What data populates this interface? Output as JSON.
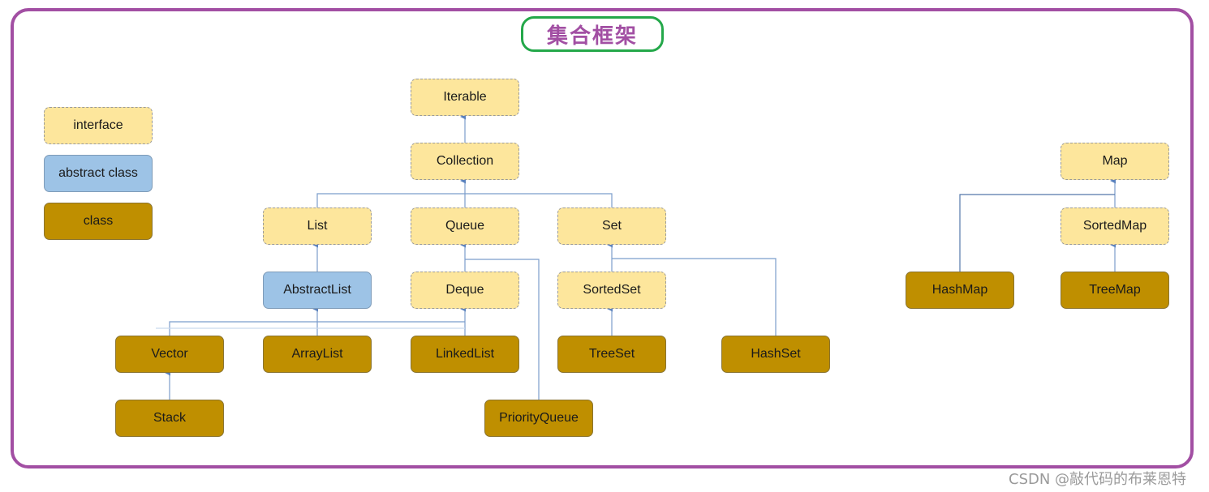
{
  "title": "集合框架",
  "legend": {
    "interface": "interface",
    "abstract": "abstract class",
    "class": "class"
  },
  "nodes": {
    "iterable": "Iterable",
    "collection": "Collection",
    "list": "List",
    "queue": "Queue",
    "set": "Set",
    "abstractlist": "AbstractList",
    "deque": "Deque",
    "sortedset": "SortedSet",
    "vector": "Vector",
    "arraylist": "ArrayList",
    "linkedlist": "LinkedList",
    "treeset": "TreeSet",
    "hashset": "HashSet",
    "stack": "Stack",
    "priorityqueue": "PriorityQueue",
    "map": "Map",
    "sortedmap": "SortedMap",
    "hashmap": "HashMap",
    "treemap": "TreeMap"
  },
  "edges": [
    {
      "child": "Collection",
      "parent": "Iterable"
    },
    {
      "child": "List",
      "parent": "Collection"
    },
    {
      "child": "Queue",
      "parent": "Collection"
    },
    {
      "child": "Set",
      "parent": "Collection"
    },
    {
      "child": "AbstractList",
      "parent": "List"
    },
    {
      "child": "Deque",
      "parent": "Queue"
    },
    {
      "child": "PriorityQueue",
      "parent": "Queue"
    },
    {
      "child": "SortedSet",
      "parent": "Set"
    },
    {
      "child": "HashSet",
      "parent": "Set"
    },
    {
      "child": "Vector",
      "parent": "AbstractList"
    },
    {
      "child": "ArrayList",
      "parent": "AbstractList"
    },
    {
      "child": "LinkedList",
      "parent": "AbstractList"
    },
    {
      "child": "LinkedList",
      "parent": "Deque"
    },
    {
      "child": "Stack",
      "parent": "Vector"
    },
    {
      "child": "TreeSet",
      "parent": "SortedSet"
    },
    {
      "child": "SortedMap",
      "parent": "Map"
    },
    {
      "child": "HashMap",
      "parent": "Map"
    },
    {
      "child": "TreeMap",
      "parent": "SortedMap"
    }
  ],
  "colors": {
    "frame": "#a24fa3",
    "title_border": "#24a84a",
    "interface_fill": "#fde69c",
    "abstract_fill": "#9dc3e6",
    "class_fill": "#bf8f00",
    "connector": "#6f93c6"
  },
  "watermark": "CSDN @敲代码的布莱恩特"
}
